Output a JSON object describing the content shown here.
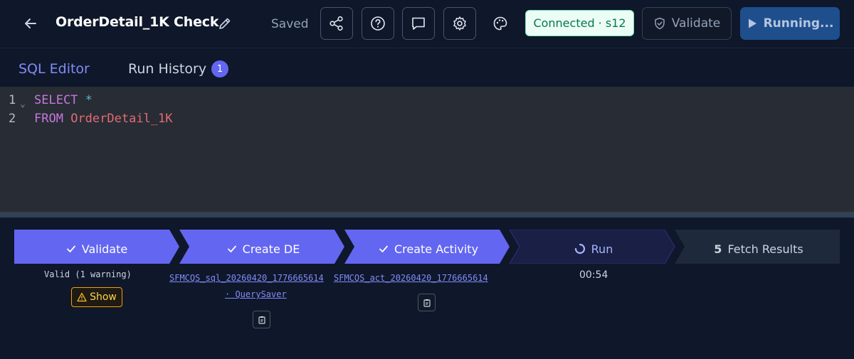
{
  "header": {
    "title": "OrderDetail_1K Check",
    "saved_label": "Saved",
    "connection_status": "Connected · s12",
    "validate_label": "Validate",
    "running_label": "Running...",
    "icons": [
      "back-arrow-icon",
      "pencil-icon",
      "share-icon",
      "help-icon",
      "comment-icon",
      "gear-icon",
      "palette-icon",
      "shield-check-icon",
      "play-icon"
    ]
  },
  "tabs": [
    {
      "label": "SQL Editor",
      "active": true
    },
    {
      "label": "Run History",
      "badge": "1",
      "active": false
    }
  ],
  "editor": {
    "lines": [
      {
        "number": "1",
        "keyword": "SELECT",
        "rest": "*"
      },
      {
        "number": "2",
        "keyword": "FROM",
        "rest": "OrderDetail_1K"
      }
    ]
  },
  "pipeline": {
    "steps": [
      {
        "label": "Validate",
        "status": "done",
        "icon": "check-icon"
      },
      {
        "label": "Create DE",
        "status": "done",
        "icon": "check-icon"
      },
      {
        "label": "Create Activity",
        "status": "done",
        "icon": "check-icon"
      },
      {
        "label": "Run",
        "status": "running",
        "icon": "spinner-icon"
      },
      {
        "label": "Fetch Results",
        "status": "pending",
        "number": "5"
      }
    ],
    "validate_result": "Valid (1 warning)",
    "show_label": "Show",
    "de_name": "SFMCQS_sql_20260420_1776665614",
    "de_folder": "· QuerySaver",
    "activity_name": "SFMCQS_act_20260420_1776665614",
    "elapsed": "00:54"
  },
  "colors": {
    "background": "#0f172a",
    "accent": "#6366f1",
    "step_done": "#6366f1",
    "step_running": "#1a1f45",
    "step_pending": "#1e293b",
    "connected_bg": "#ecfdf5",
    "connected_text": "#047857",
    "running_button": "#1e4e8c"
  }
}
